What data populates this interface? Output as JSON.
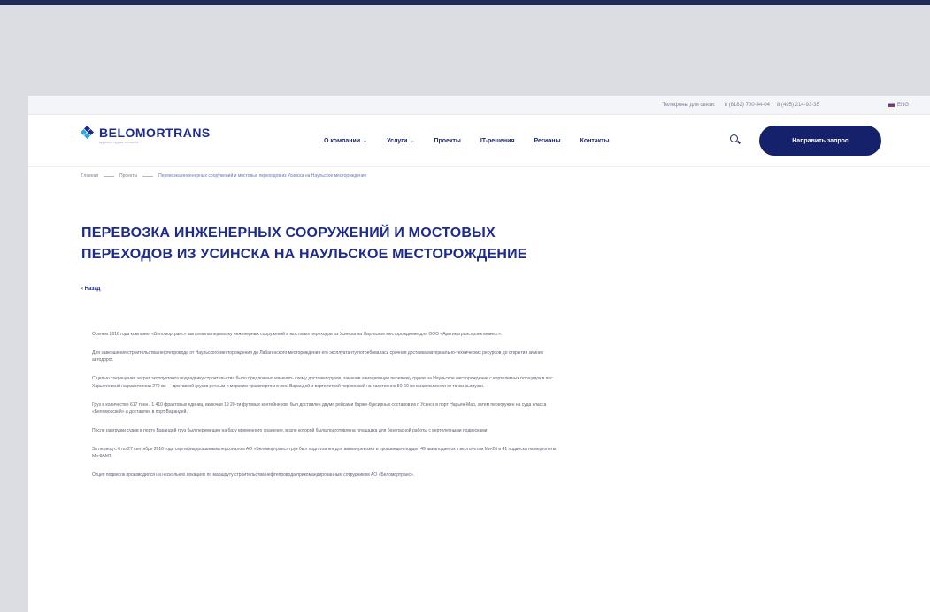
{
  "topbar": {
    "phones_label": "Телефоны для связи:",
    "phone_1": "8 (8182) 700-44-04",
    "phone_2": "8 (495) 214-93-35",
    "lang": "ENG"
  },
  "header": {
    "logo_name": "BELOMORTRANS",
    "logo_tagline": "крупные грузы, проекты",
    "nav": [
      {
        "label": "О компании",
        "has_dropdown": true
      },
      {
        "label": "Услуги",
        "has_dropdown": true
      },
      {
        "label": "Проекты",
        "has_dropdown": false
      },
      {
        "label": "IT-решения",
        "has_dropdown": false
      },
      {
        "label": "Регионы",
        "has_dropdown": false
      },
      {
        "label": "Контакты",
        "has_dropdown": false
      }
    ],
    "cta": "Направить запрос"
  },
  "breadcrumb": {
    "home": "Главная",
    "section": "Проекты",
    "current": "Перевозка инженерных сооружений и мостовых переходов из Усинска на Наульское месторождение"
  },
  "title": "Перевозка инженерных сооружений и мостовых переходов из Усинска на Наульское месторождение",
  "back": "Назад",
  "paragraphs": [
    "Осенью 2016 года компания «Беломортранс» выполнила перевозку инженерных сооружений и мостовых переходов из Усинска на Наульское месторождение для ООО «Арктикатранспроектинвест».",
    "Для завершения строительства нефтепровода от Наульского месторождения до Лабаганского месторождения его эксплуатанту потребовалась срочная доставка материально-технических ресурсов до открытия зимних автодорог.",
    "С целью сокращения затрат эксплуатанта подрядчику строительства было предложено изменить схему доставки грузов, заменив авиационную перевозку грузов на Наульское месторождение с вертолетных площадок в пос. Харьягинский на расстоянии 270 км — доставкой грузов речным и морским транспортом в пос. Варандей и вертолетной перевозкой на расстояние 50-60 км в зависимости от точки выгрузки.",
    "Груз в количестве 617 тонн / 1 410 фрахтовых единиц, включая 19 20-ти футовых контейнеров, был доставлен двумя рейсами барже-буксирных составов из г. Усинск в порт Нарьян-Мар, затем перегружен на суда класса «Беломорский» и доставлен в порт Варандей.",
    "После разгрузки судов в порту Варандей груз был перемещен на базу временного хранения, возле которой была подготовлена площадка для безопасной работы с вертолетными подвесками.",
    "За период с 6 по 27 сентября 2016 года сертифицированным персоналом АО «Беломортранс» груз был подготовлен для авиаперевозки и произведен подцеп 49 авиаподвесок к вертолетам Ми-26 и 41 подвеска на вертолеты Ми-8АМТ.",
    "Отцеп подвесок производился на нескольких локациях по маршруту строительства нефтепровода прикомандированным сотрудником АО «Беломортранс»."
  ]
}
